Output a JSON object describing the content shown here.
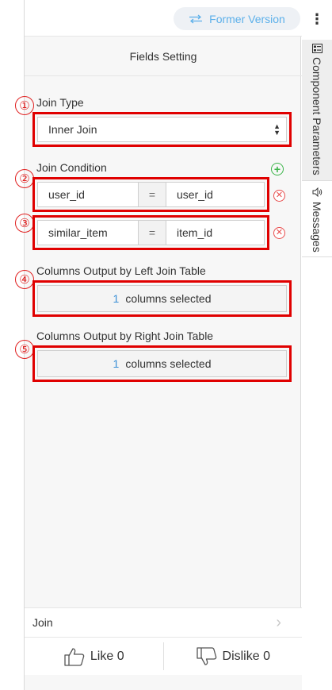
{
  "header": {
    "former_version_label": "Former Version",
    "more_icon": "⋮"
  },
  "panel": {
    "title": "Fields Setting",
    "join_type": {
      "badge": "①",
      "label": "Join Type",
      "value": "Inner Join"
    },
    "join_condition": {
      "badge_1": "②",
      "badge_2": "③",
      "label": "Join Condition",
      "equals": "=",
      "rows": [
        {
          "left": "user_id",
          "right": "user_id"
        },
        {
          "left": "similar_item",
          "right": "item_id"
        }
      ]
    },
    "left_output": {
      "badge": "④",
      "label": "Columns Output by Left Join Table",
      "count": "1",
      "suffix": "columns selected"
    },
    "right_output": {
      "badge": "⑤",
      "label": "Columns Output by Right Join Table",
      "count": "1",
      "suffix": "columns selected"
    }
  },
  "footer": {
    "component_name": "Join",
    "like_label": "Like 0",
    "dislike_label": "Dislike 0"
  },
  "rail": {
    "tabs": [
      {
        "label": "Component Parameters",
        "icon": "parameters-icon"
      },
      {
        "label": "Messages",
        "icon": "speaker-icon"
      }
    ]
  },
  "colors": {
    "highlight": "#e00000",
    "accent": "#5cb0ea",
    "add": "#3cb54a",
    "remove": "#e84c4c",
    "count": "#3a8fd6"
  }
}
